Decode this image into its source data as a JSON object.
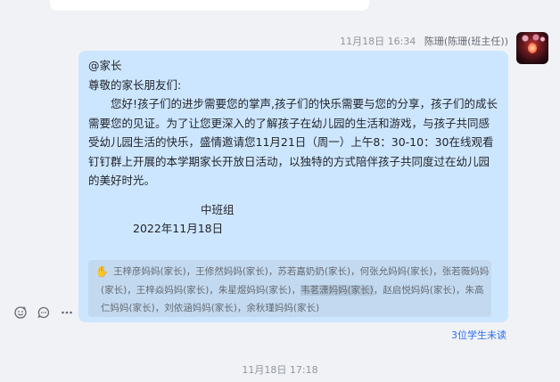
{
  "message": {
    "timestamp": "11月18日 16:34",
    "sender": "陈珊(陈珊(班主任))",
    "lines": [
      "@家长",
      "尊敬的家长朋友们:",
      "您好!孩子们的进步需要您的掌声,孩子们的快乐需要与您的分享，孩子们的成长需要您的见证。为了让您更深入的了解孩子在幼儿园的生活和游戏，与孩子共同感受幼儿园生活的快乐，盛情邀请您11月21日（周一）上午8：30-10：30在线观看钉钉群上开展的本学期家长开放日活动，以独特的方式陪伴孩子共同度过在幼儿园的美好时光。",
      "中班组",
      "2022年11月18日"
    ],
    "read_by": "王梓彦妈妈(家长)，王修然妈妈(家长)，苏若嘉奶奶(家长)，何张允妈妈(家长)，张若薇妈妈(家长)，王梓焱妈妈(家长)，朱星煜妈妈(家长)，",
    "read_by_highlight": "韦茗潇妈妈(家长)",
    "read_by_tail": "，赵启悦妈妈(家长)，朱高仁妈妈(家长)，刘依涵妈妈(家长)，余秋瑾妈妈(家长)",
    "unread_label": "3位学生未读"
  },
  "actions": [
    "react-icon",
    "reply-icon",
    "more-icon"
  ],
  "next_timestamp": "11月18日 17:18",
  "colors": {
    "bubble": "#cde6ff",
    "link": "#2a6ef0",
    "background": "#f1f2f5"
  }
}
